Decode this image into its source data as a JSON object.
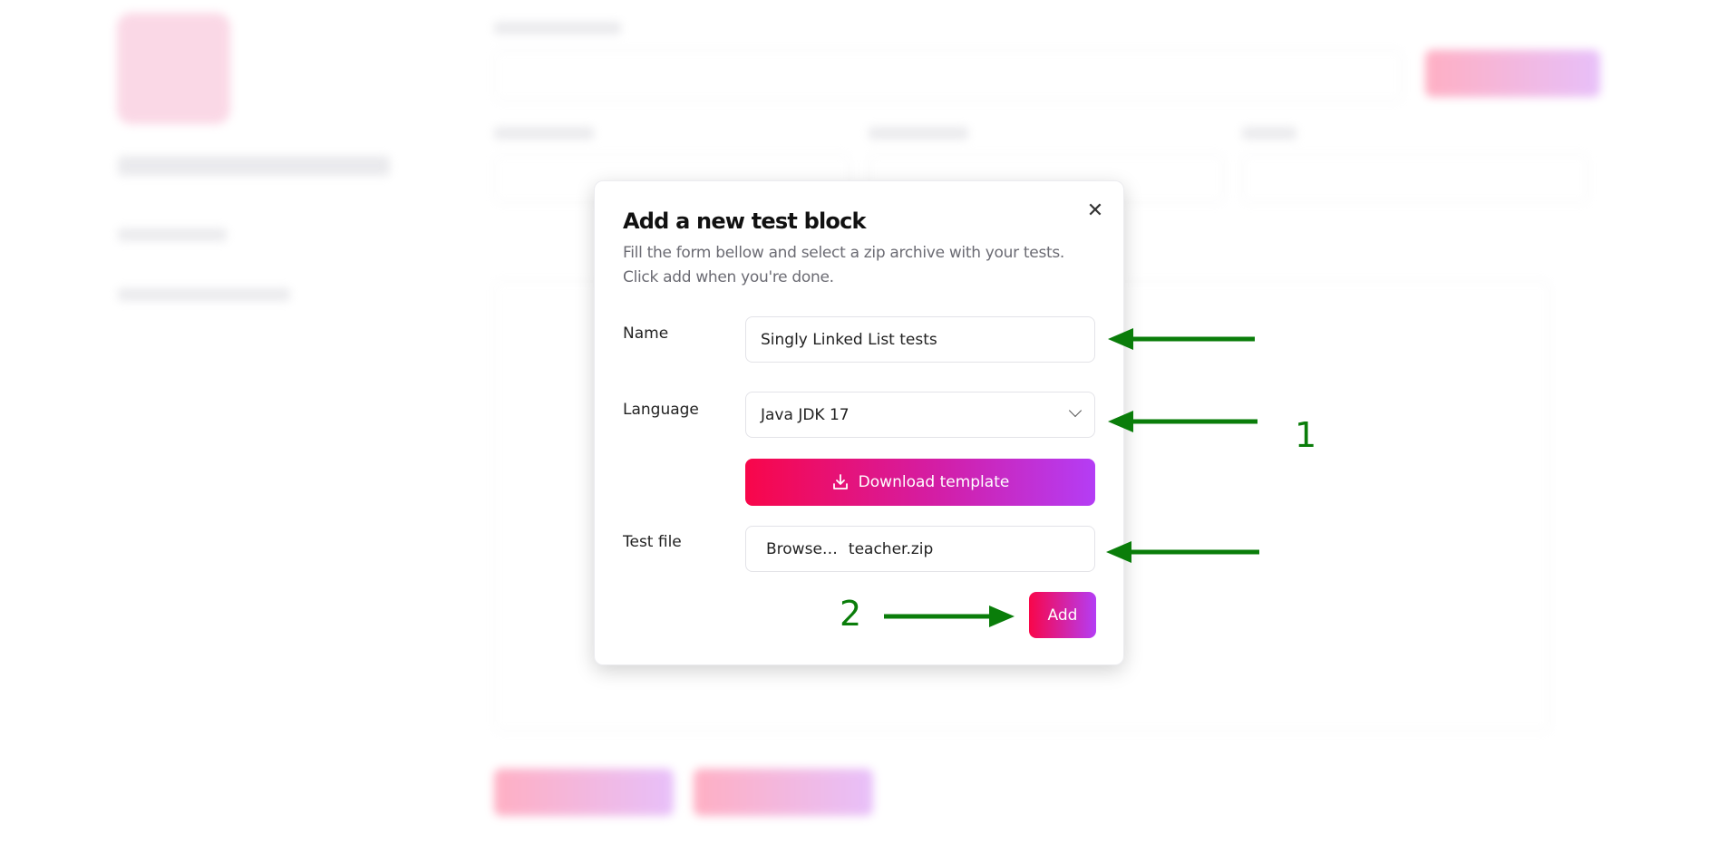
{
  "modal": {
    "title": "Add a new test block",
    "description": "Fill the form bellow and select a zip archive with your tests. Click add when you're done.",
    "close_icon": "close-icon",
    "name_label": "Name",
    "name_value": "Singly Linked List tests",
    "language_label": "Language",
    "language_value": "Java JDK 17",
    "download_label": "Download template",
    "download_icon": "download-icon",
    "testfile_label": "Test file",
    "browse_label": "Browse…",
    "file_name": "teacher.zip",
    "add_label": "Add"
  },
  "annotations": {
    "step1": "1",
    "step2": "2",
    "arrow_color": "#0a7d0a"
  },
  "colors": {
    "gradient_start": "#f8064a",
    "gradient_end": "#b43df5"
  }
}
